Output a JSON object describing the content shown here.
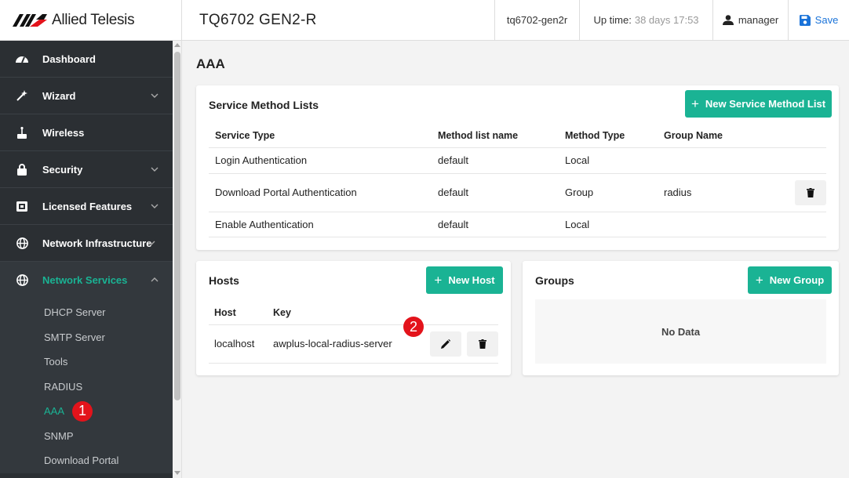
{
  "header": {
    "brand": "Allied Telesis",
    "device": "TQ6702 GEN2-R",
    "hostname": "tq6702-gen2r",
    "uptime_label": "Up time:",
    "uptime_value": "38 days 17:53",
    "user": "manager",
    "save_label": "Save"
  },
  "sidebar": {
    "items": [
      {
        "label": "Dashboard",
        "icon": "dashboard-icon"
      },
      {
        "label": "Wizard",
        "icon": "magic-wand-icon"
      },
      {
        "label": "Wireless",
        "icon": "wireless-icon"
      },
      {
        "label": "Security",
        "icon": "lock-icon"
      },
      {
        "label": "Licensed Features",
        "icon": "license-icon"
      },
      {
        "label": "Network Infrastructure",
        "icon": "globe-icon"
      },
      {
        "label": "Network Services",
        "icon": "globe-icon"
      }
    ],
    "subitems": [
      "DHCP Server",
      "SMTP Server",
      "Tools",
      "RADIUS",
      "AAA",
      "SNMP",
      "Download Portal"
    ],
    "callout_1": "1"
  },
  "main": {
    "title": "AAA",
    "service_method": {
      "title": "Service Method Lists",
      "new_button": "New Service Method List",
      "columns": [
        "Service Type",
        "Method list name",
        "Method Type",
        "Group Name"
      ],
      "rows": [
        {
          "service": "Login Authentication",
          "list": "default",
          "type": "Local",
          "group": ""
        },
        {
          "service": "Download Portal Authentication",
          "list": "default",
          "type": "Group",
          "group": "radius"
        },
        {
          "service": "Enable Authentication",
          "list": "default",
          "type": "Local",
          "group": ""
        }
      ]
    },
    "hosts": {
      "title": "Hosts",
      "new_button": "New Host",
      "columns": [
        "Host",
        "Key"
      ],
      "rows": [
        {
          "host": "localhost",
          "key": "awplus-local-radius-server"
        }
      ],
      "callout_2": "2"
    },
    "groups": {
      "title": "Groups",
      "new_button": "New Group",
      "empty": "No Data"
    }
  },
  "colors": {
    "accent": "#1ab394",
    "sidebar_bg": "#2b2f33",
    "save_blue": "#1a73d9",
    "callout_red": "#e3131b"
  }
}
